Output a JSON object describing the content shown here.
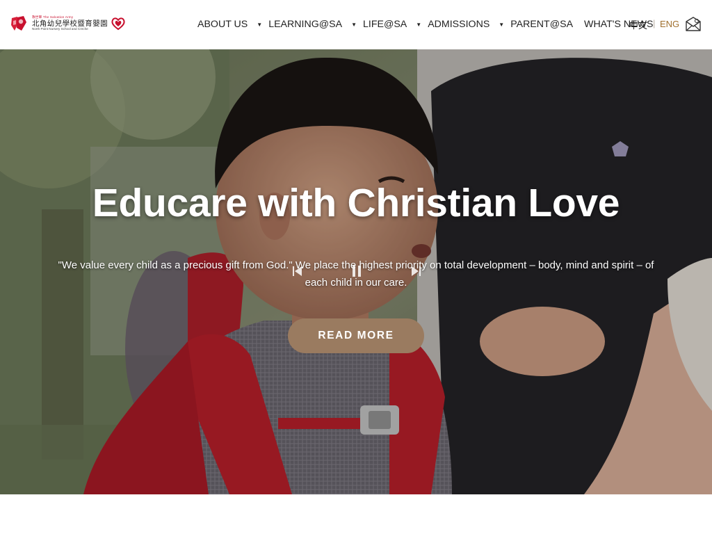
{
  "header": {
    "logo": {
      "small_top": "救世軍 The Salvation Army",
      "name_cn": "北角幼兒學校暨育嬰園",
      "name_en": "North Point Nursery School and Creche"
    },
    "nav": [
      {
        "label": "ABOUT US",
        "has_dropdown": true
      },
      {
        "label": "LEARNING@SA",
        "has_dropdown": true
      },
      {
        "label": "LIFE@SA",
        "has_dropdown": true
      },
      {
        "label": "ADMISSIONS",
        "has_dropdown": true
      },
      {
        "label": "PARENT@SA",
        "has_dropdown": false
      },
      {
        "label": "WHAT'S NEWS",
        "has_dropdown": false
      }
    ],
    "dropdown_caret": "▼",
    "lang_cn": "中文",
    "lang_separator": "|",
    "lang_en": "ENG",
    "mail_icon": "envelope-icon"
  },
  "hero": {
    "title": "Educare with Christian Love",
    "subtitle": "\"We value every child as a precious gift from God.\" We place the highest priority on total development – body, mind and spirit – of each child in our care.",
    "button": "READ MORE",
    "controls": {
      "prev_icon": "previous-icon",
      "pause_icon": "pause-icon",
      "next_icon": "next-icon"
    }
  },
  "colors": {
    "accent_gold": "#a0702e",
    "button_brown": "#9a7b60",
    "logo_red": "#c8102e",
    "text_dark": "#222222"
  }
}
